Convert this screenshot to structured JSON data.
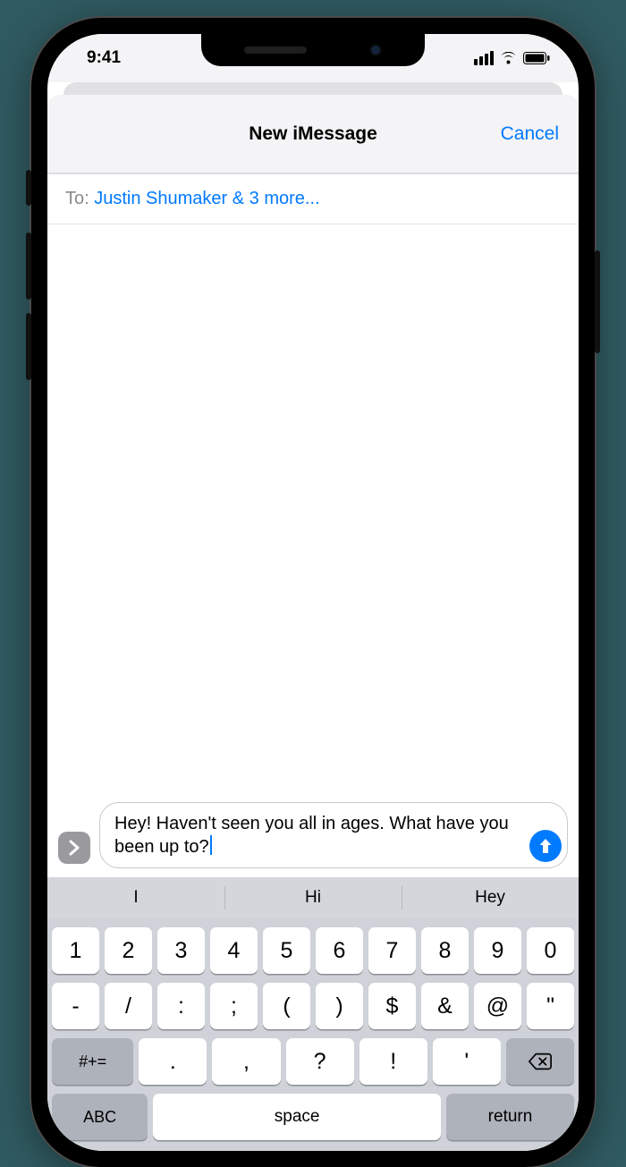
{
  "status": {
    "time": "9:41"
  },
  "header": {
    "title": "New iMessage",
    "cancel": "Cancel"
  },
  "to": {
    "label": "To:",
    "value": "Justin Shumaker & 3 more..."
  },
  "compose": {
    "text": "Hey! Haven't seen you all in ages. What have you been up to?"
  },
  "suggestions": [
    "I",
    "Hi",
    "Hey"
  ],
  "keyboard": {
    "row1": [
      "1",
      "2",
      "3",
      "4",
      "5",
      "6",
      "7",
      "8",
      "9",
      "0"
    ],
    "row2": [
      "-",
      "/",
      ":",
      ";",
      "(",
      ")",
      "$",
      "&",
      "@",
      "\""
    ],
    "row3_sym": "#+=",
    "row3": [
      ".",
      ",",
      "?",
      "!",
      "'"
    ],
    "abc": "ABC",
    "space": "space",
    "return": "return"
  }
}
